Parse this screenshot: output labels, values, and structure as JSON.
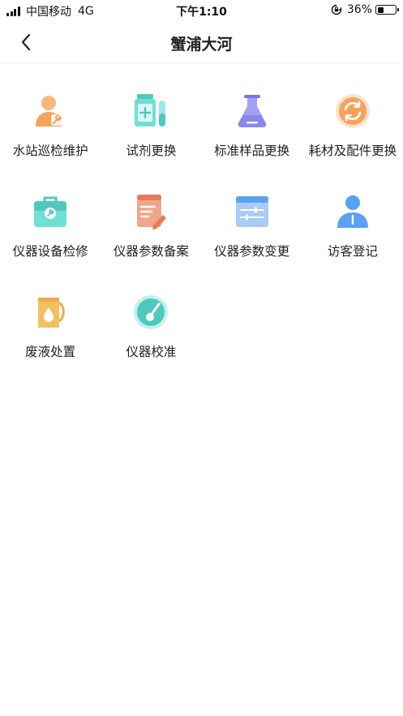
{
  "status_bar": {
    "carrier": "中国移动",
    "network": "4G",
    "time": "下午1:10",
    "battery_percent": "36%",
    "battery_level": 0.36
  },
  "nav": {
    "title": "蟹浦大河",
    "back_icon": "chevron-left-icon"
  },
  "colors": {
    "orange": "#F5A25D",
    "teal": "#5DD9CE",
    "purple": "#8C87EE",
    "blue": "#5AA2F0",
    "coral": "#EE8A6B",
    "gold": "#F2C15E"
  },
  "tiles": [
    {
      "label": "水站巡检维护",
      "icon": "maintenance-worker-icon"
    },
    {
      "label": "试剂更换",
      "icon": "reagent-bottle-icon"
    },
    {
      "label": "标准样品更换",
      "icon": "flask-icon"
    },
    {
      "label": "耗材及配件更换",
      "icon": "refresh-parts-icon"
    },
    {
      "label": "仪器设备检修",
      "icon": "toolbox-icon"
    },
    {
      "label": "仪器参数备案",
      "icon": "notepad-icon"
    },
    {
      "label": "仪器参数变更",
      "icon": "sliders-icon"
    },
    {
      "label": "访客登记",
      "icon": "visitor-icon"
    },
    {
      "label": "废液处置",
      "icon": "waste-liquid-icon"
    },
    {
      "label": "仪器校准",
      "icon": "gauge-icon"
    }
  ]
}
